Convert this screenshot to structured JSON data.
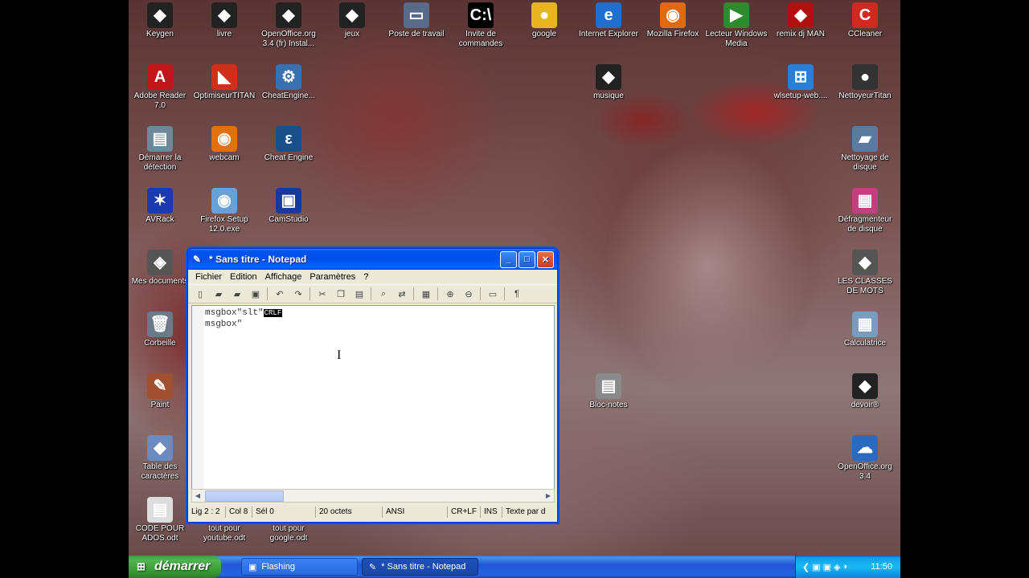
{
  "desktop": {
    "icons": [
      {
        "label": "Keygen",
        "glyph": "◆",
        "color": "#222"
      },
      {
        "label": "livre",
        "glyph": "◆",
        "color": "#222"
      },
      {
        "label": "OpenOffice.org 3.4 (fr) Instal...",
        "glyph": "◆",
        "color": "#222"
      },
      {
        "label": "jeux",
        "glyph": "◆",
        "color": "#222"
      },
      {
        "label": "Poste de travail",
        "glyph": "▭",
        "color": "#5a6b8a"
      },
      {
        "label": "Invite de commandes",
        "glyph": "C:\\",
        "color": "#000"
      },
      {
        "label": "google",
        "glyph": "●",
        "color": "#e6b520"
      },
      {
        "label": "Internet Explorer",
        "glyph": "e",
        "color": "#1f6fd0"
      },
      {
        "label": "Mozilla Firefox",
        "glyph": "◉",
        "color": "#e06a10"
      },
      {
        "label": "Lecteur Windows Media",
        "glyph": "▶",
        "color": "#2d8a2d"
      },
      {
        "label": "remix  dj MAN",
        "glyph": "◆",
        "color": "#b01010"
      },
      {
        "label": "CCleaner",
        "glyph": "C",
        "color": "#d02a20"
      },
      {
        "label": "Adobe Reader 7.0",
        "glyph": "A",
        "color": "#c0161a"
      },
      {
        "label": "OptimiseurTITAN",
        "glyph": "◣",
        "color": "#d0301a"
      },
      {
        "label": "CheatEngine...",
        "glyph": "⚙",
        "color": "#3a6fb0"
      },
      {
        "label": "musique",
        "glyph": "◆",
        "color": "#222"
      },
      {
        "label": "wlsetup-web....",
        "glyph": "⊞",
        "color": "#2a7fd4"
      },
      {
        "label": "NettoyeurTitan",
        "glyph": "●",
        "color": "#333"
      },
      {
        "label": "Démarrer la détection",
        "glyph": "▤",
        "color": "#6a8a9a"
      },
      {
        "label": "webcam",
        "glyph": "◉",
        "color": "#e07010"
      },
      {
        "label": "Cheat Engine",
        "glyph": "ε",
        "color": "#1a4f8a"
      },
      {
        "label": "Nettoyage de disque",
        "glyph": "▰",
        "color": "#5a7aa0"
      },
      {
        "label": "AVRack",
        "glyph": "✶",
        "color": "#1a3ab0"
      },
      {
        "label": "Firefox Setup 12.0.exe",
        "glyph": "◉",
        "color": "#6aa0d8"
      },
      {
        "label": "CamStudio",
        "glyph": "▣",
        "color": "#1a3a9a"
      },
      {
        "label": "Défragmenteur de disque",
        "glyph": "▦",
        "color": "#c04080"
      },
      {
        "label": "Mes documents",
        "glyph": "◈",
        "color": "#555"
      },
      {
        "label": "LES CLASSES DE MOTS",
        "glyph": "◆",
        "color": "#555"
      },
      {
        "label": "Corbeille",
        "glyph": "🗑",
        "color": "#6a7a8a"
      },
      {
        "label": "Calculatrice",
        "glyph": "▦",
        "color": "#7a9ac0"
      },
      {
        "label": "Paint",
        "glyph": "✎",
        "color": "#a05030"
      },
      {
        "label": "Bloc-notes",
        "glyph": "▤",
        "color": "#8a8a8a"
      },
      {
        "label": "devoir®",
        "glyph": "◆",
        "color": "#222"
      },
      {
        "label": "Table des caractères",
        "glyph": "◆",
        "color": "#6a8ac0"
      },
      {
        "label": "OpenOffice.org 3.4",
        "glyph": "☁",
        "color": "#2a6ac0"
      },
      {
        "label": "CODE POUR ADOS.odt",
        "glyph": "▤",
        "color": "#ddd"
      },
      {
        "label": "tout pour youtube.odt",
        "glyph": "▤",
        "color": "#ddd"
      },
      {
        "label": "tout pour google.odt",
        "glyph": "▤",
        "color": "#ddd"
      }
    ]
  },
  "notepad": {
    "title": "* Sans titre - Notepad",
    "menu": [
      "Fichier",
      "Edition",
      "Affichage",
      "Paramètres",
      "?"
    ],
    "line1": "msgbox\"slt\"",
    "crlf_marker": "CRLF",
    "line2": "msgbox\"",
    "status": {
      "position": "Lig 2 : 2",
      "col": "Col 8",
      "sel": "Sél 0",
      "size": "20 octets",
      "encoding": "ANSI",
      "eol": "CR+LF",
      "mode": "INS",
      "type": "Texte par d"
    }
  },
  "taskbar": {
    "start_label": "démarrer",
    "tasks": [
      "Flashing",
      "* Sans titre - Notepad"
    ],
    "clock": "11:50"
  }
}
